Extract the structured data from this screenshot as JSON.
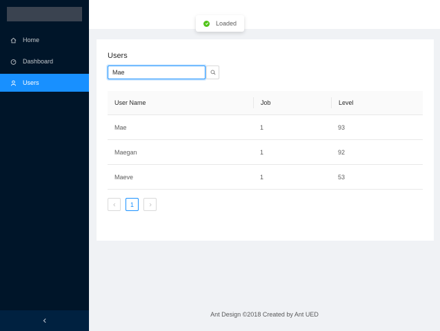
{
  "sidebar": {
    "items": [
      {
        "label": "Home",
        "icon": "home-icon"
      },
      {
        "label": "Dashboard",
        "icon": "dashboard-icon"
      },
      {
        "label": "Users",
        "icon": "user-icon",
        "active": true
      }
    ],
    "collapse_icon": "chevron-left-icon"
  },
  "message": {
    "text": "Loaded",
    "icon": "check-circle-icon",
    "color": "#52c41a"
  },
  "card": {
    "title": "Users",
    "search": {
      "value": "Mae",
      "icon": "search-icon"
    }
  },
  "table": {
    "columns": [
      "User Name",
      "Job",
      "Level"
    ],
    "rows": [
      [
        "Mae",
        "1",
        "93"
      ],
      [
        "Maegan",
        "1",
        "92"
      ],
      [
        "Maeve",
        "1",
        "53"
      ]
    ]
  },
  "pagination": {
    "prev_icon": "chevron-left-icon",
    "current_page": "1",
    "next_icon": "chevron-right-icon"
  },
  "footer": {
    "text": "Ant Design ©2018 Created by Ant UED"
  },
  "colors": {
    "sider": "#001529",
    "primary": "#1890ff",
    "success": "#52c41a"
  }
}
